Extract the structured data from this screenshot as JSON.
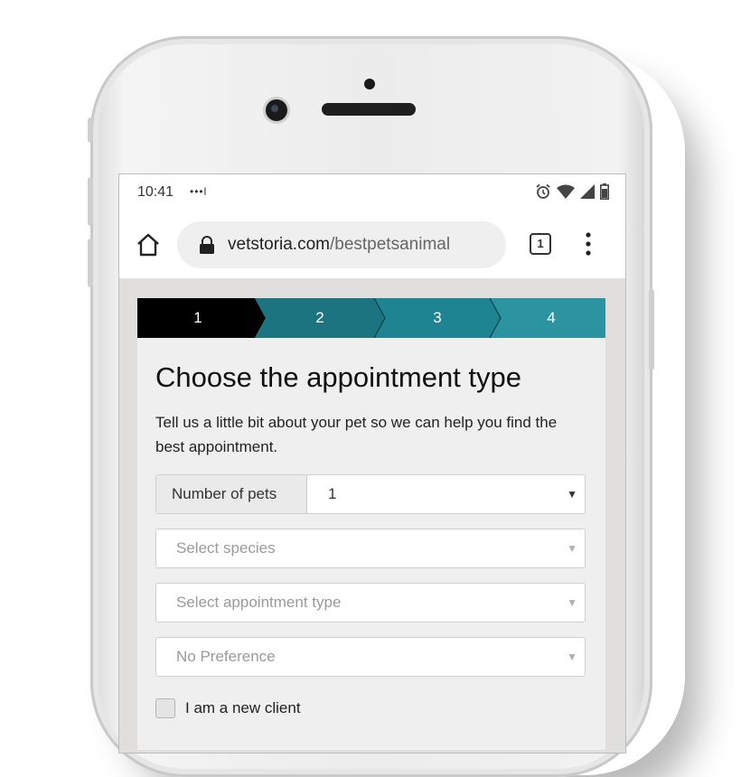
{
  "status_bar": {
    "time": "10:41",
    "dots": "•••l"
  },
  "browser": {
    "url_domain": "vetstoria.com",
    "url_path": "/bestpetsanimal",
    "tab_count": "1"
  },
  "stepper": {
    "steps": [
      "1",
      "2",
      "3",
      "4"
    ],
    "active_step": "1",
    "active_color": "#000000",
    "step_colors": [
      "#000000",
      "#1b7480",
      "#1f8491",
      "#2b94a0"
    ]
  },
  "form": {
    "title": "Choose the appointment type",
    "subtitle": "Tell us a little bit about your pet so we can help you find the best appointment.",
    "pets_label": "Number of pets",
    "pets_value": "1",
    "species_placeholder": "Select species",
    "appointment_placeholder": "Select appointment type",
    "preference_value": "No Preference",
    "caret": "▼",
    "new_client_label": "I am a new client"
  }
}
